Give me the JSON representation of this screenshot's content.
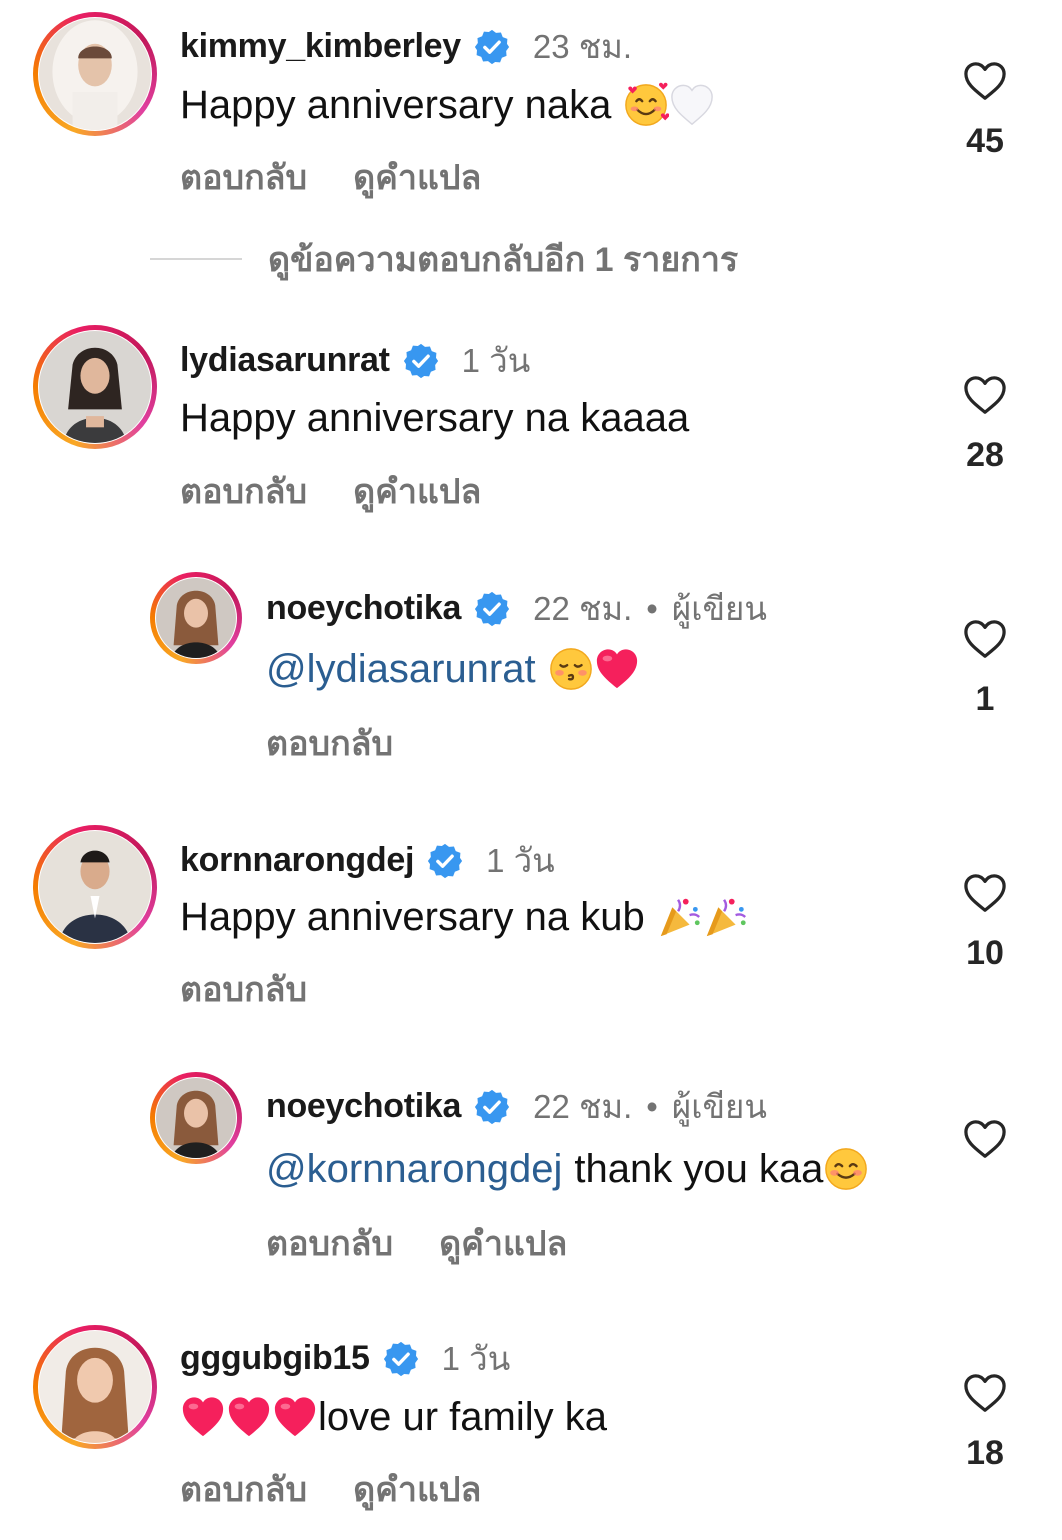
{
  "comments": [
    {
      "username": "kimmy_kimberley",
      "time": "23 ชม.",
      "text": "Happy anniversary naka",
      "emojis": [
        "smiling-face-with-hearts",
        "white-heart"
      ],
      "actions": [
        "ตอบกลับ",
        "ดูคำแปล"
      ],
      "likes": "45",
      "view_replies": "ดูข้อความตอบกลับอีก 1 รายการ"
    },
    {
      "username": "lydiasarunrat",
      "time": "1 วัน",
      "text": "Happy anniversary na kaaaa",
      "actions": [
        "ตอบกลับ",
        "ดูคำแปล"
      ],
      "likes": "28"
    },
    {
      "username": "noeychotika",
      "time": "22 ชม.",
      "author_label": "ผู้เขียน",
      "mention": "@lydiasarunrat",
      "emojis": [
        "kissing-face",
        "red-heart"
      ],
      "actions": [
        "ตอบกลับ"
      ],
      "likes": "1"
    },
    {
      "username": "kornnarongdej",
      "time": "1 วัน",
      "text": "Happy anniversary na kub",
      "emojis": [
        "party-popper",
        "party-popper"
      ],
      "actions": [
        "ตอบกลับ"
      ],
      "likes": "10"
    },
    {
      "username": "noeychotika",
      "time": "22 ชม.",
      "author_label": "ผู้เขียน",
      "mention": "@kornnarongdej",
      "text": "thank you kaa",
      "emojis": [
        "smiling-face"
      ],
      "actions": [
        "ตอบกลับ",
        "ดูคำแปล"
      ],
      "likes": ""
    },
    {
      "username": "gggubgib15",
      "time": "1 วัน",
      "text": "love ur family ka",
      "emojis": [
        "red-heart",
        "red-heart",
        "red-heart"
      ],
      "actions": [
        "ตอบกลับ",
        "ดูคำแปล"
      ],
      "likes": "18"
    }
  ],
  "colors": {
    "verified": "#3897f0",
    "mention": "#2b5e91",
    "secondary_text": "#737373"
  }
}
